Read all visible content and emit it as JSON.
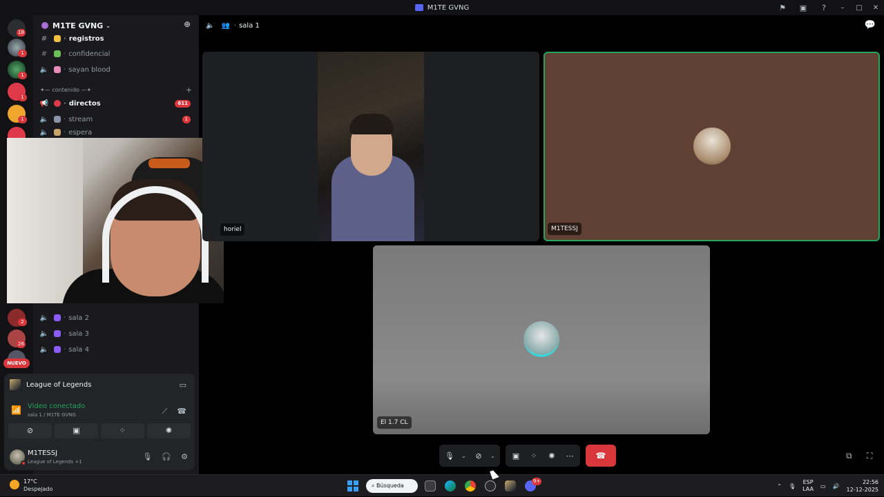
{
  "window": {
    "title": "M1TE GVNG"
  },
  "server_rail": {
    "badges": [
      "18",
      "1",
      "1",
      "1",
      "1",
      "2",
      "26"
    ],
    "nuevo_label": "NUEVO"
  },
  "guild": {
    "name": "M1TE GVNG"
  },
  "channels": {
    "top": [
      {
        "name": "registros",
        "type": "text"
      },
      {
        "name": "confidencial",
        "type": "text"
      },
      {
        "name": "sayan blood",
        "type": "voice"
      }
    ],
    "category": "✦— contenido —✦",
    "content": [
      {
        "name": "directos",
        "badge": "611"
      },
      {
        "name": "stream",
        "badge": "1"
      },
      {
        "name": "espera",
        "badge": ""
      }
    ],
    "voice_rooms": [
      "sala 2",
      "sala 3",
      "sala 4"
    ]
  },
  "activity": {
    "game": "League of Legends",
    "voice_status": "Video conectado",
    "voice_location": "sala 1 / M1TE GVNG"
  },
  "user": {
    "name": "M1TESSJ",
    "status": "League of Legends +1"
  },
  "main": {
    "channel_name": "sala 1",
    "tiles": [
      {
        "label": "horiel"
      },
      {
        "label": "M1TESSJ"
      },
      {
        "label": "El 1.7 CL"
      }
    ]
  },
  "taskbar": {
    "temperature": "17°C",
    "condition": "Despejado",
    "search_placeholder": "Búsqueda",
    "discord_badge": "9+",
    "lang_line1": "ESP",
    "lang_line2": "LAA",
    "time": "22:56",
    "date": "12-12-2025"
  },
  "colors": {
    "accent": "#5865f2",
    "danger": "#da373c",
    "online": "#23a55a",
    "bg_dark": "#121214",
    "channels_bg": "#1a1a1e"
  },
  "icons": [
    "discord-logo-icon",
    "flag-icon",
    "screen-icon",
    "help-icon",
    "hash-icon",
    "speaker-icon",
    "add-member-icon",
    "signal-icon",
    "camera-off-icon",
    "share-screen-icon",
    "activities-icon",
    "soundboard-icon",
    "mic-icon",
    "headphones-icon",
    "gear-icon",
    "hangup-icon",
    "more-icon",
    "popout-icon",
    "fullscreen-icon",
    "chat-icon"
  ]
}
